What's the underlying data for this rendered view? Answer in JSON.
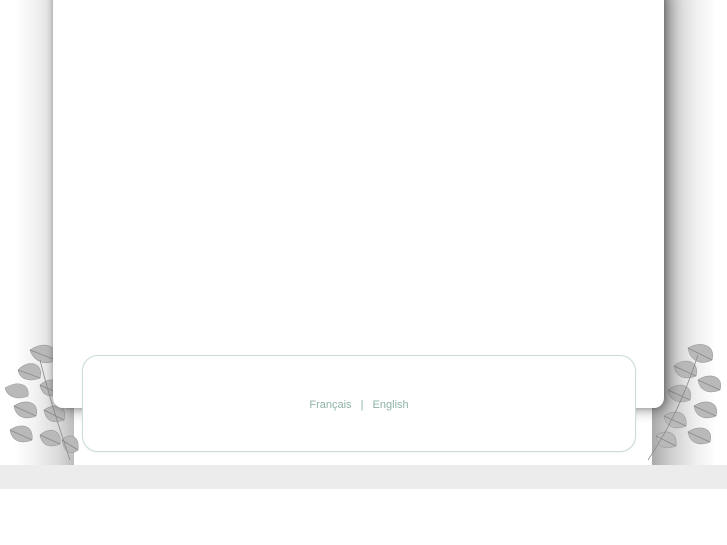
{
  "footer": {
    "languages": [
      {
        "label": "Français"
      },
      {
        "label": "English"
      }
    ],
    "separator": "|"
  },
  "colors": {
    "background": "#ffffff",
    "link": "#8fb3a9",
    "footer_border": "#c9dcd6",
    "bottom_band": "#ececec"
  },
  "icons": {
    "left_decoration": "leaves-icon",
    "right_decoration": "leaves-icon"
  }
}
